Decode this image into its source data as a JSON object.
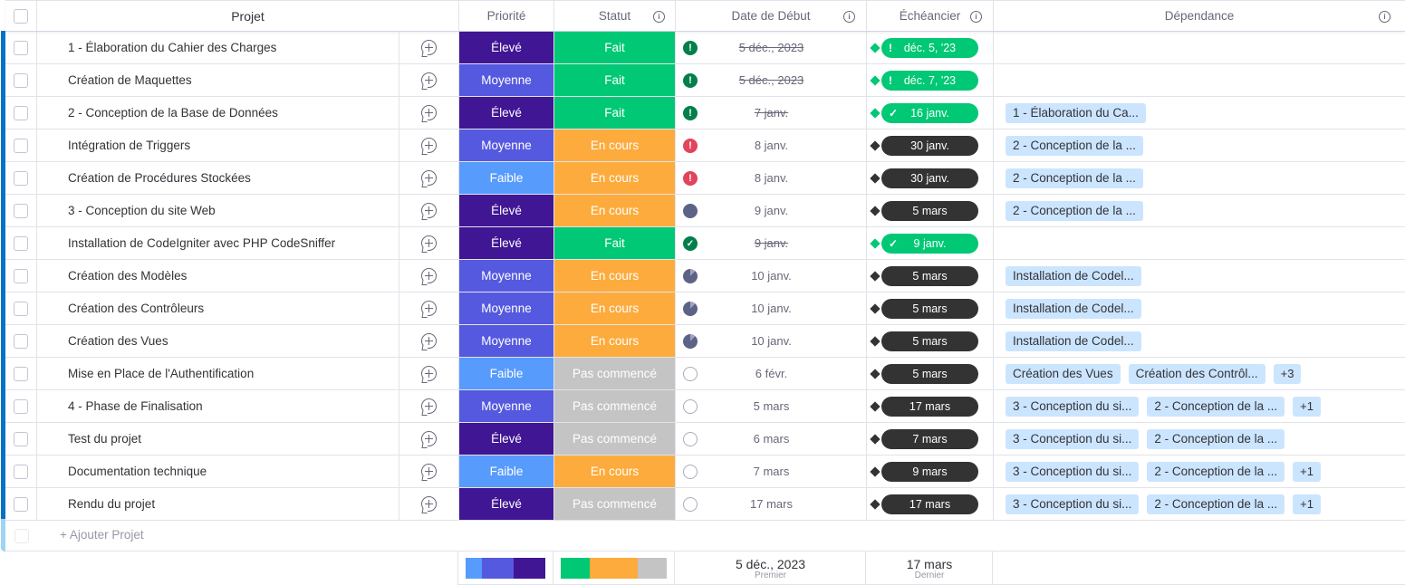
{
  "columns": {
    "name": "Projet",
    "priority": "Priorité",
    "status": "Statut",
    "start_date": "Date de Début",
    "due": "Échéancier",
    "dependency": "Dépendance"
  },
  "colors": {
    "prio_high": "#401694",
    "prio_medium": "#5559df",
    "prio_low": "#579bfc",
    "status_done": "#00c875",
    "status_working": "#fdab3d",
    "status_not_started": "#c4c4c4",
    "done_icon": "#037f4c",
    "alert_icon": "#e2445c",
    "progress_icon": "#5d6387",
    "due_done": "#00c875",
    "due_pending": "#333333",
    "dependency_tag": "#cce5ff",
    "group_accent": "#0073c2"
  },
  "rows": [
    {
      "name": "1 - Élaboration du Cahier des Charges",
      "priority": "Élevé",
      "priority_level": "high",
      "status": "Fait",
      "status_level": "done",
      "date_icon": "alert-done",
      "start": "5 déc., 2023",
      "strike": true,
      "due": "déc. 5, '23",
      "due_state": "done-late",
      "deps": []
    },
    {
      "name": "Création de Maquettes",
      "priority": "Moyenne",
      "priority_level": "medium",
      "status": "Fait",
      "status_level": "done",
      "date_icon": "alert-done",
      "start": "5 déc., 2023",
      "strike": true,
      "due": "déc. 7, '23",
      "due_state": "done-late",
      "deps": []
    },
    {
      "name": "2 - Conception de la Base de Données",
      "priority": "Élevé",
      "priority_level": "high",
      "status": "Fait",
      "status_level": "done",
      "date_icon": "alert-done",
      "start": "7 janv.",
      "strike": true,
      "due": "16 janv.",
      "due_state": "done",
      "deps": [
        "1 - Élaboration du Ca..."
      ]
    },
    {
      "name": "Intégration de Triggers",
      "priority": "Moyenne",
      "priority_level": "medium",
      "status": "En cours",
      "status_level": "working",
      "date_icon": "alert",
      "start": "8 janv.",
      "strike": false,
      "due": "30 janv.",
      "due_state": "pending",
      "deps": [
        "2 - Conception de la ..."
      ]
    },
    {
      "name": "Création de Procédures Stockées",
      "priority": "Faible",
      "priority_level": "low",
      "status": "En cours",
      "status_level": "working",
      "date_icon": "alert",
      "start": "8 janv.",
      "strike": false,
      "due": "30 janv.",
      "due_state": "pending",
      "deps": [
        "2 - Conception de la ..."
      ]
    },
    {
      "name": "3 - Conception du site Web",
      "priority": "Élevé",
      "priority_level": "high",
      "status": "En cours",
      "status_level": "working",
      "date_icon": "progress-full",
      "start": "9 janv.",
      "strike": false,
      "due": "5 mars",
      "due_state": "pending",
      "deps": [
        "2 - Conception de la ..."
      ]
    },
    {
      "name": "Installation de CodeIgniter avec PHP CodeSniffer",
      "priority": "Élevé",
      "priority_level": "high",
      "status": "Fait",
      "status_level": "done",
      "date_icon": "check",
      "start": "9 janv.",
      "strike": true,
      "due": "9 janv.",
      "due_state": "done",
      "deps": []
    },
    {
      "name": "Création des Modèles",
      "priority": "Moyenne",
      "priority_level": "medium",
      "status": "En cours",
      "status_level": "working",
      "date_icon": "progress",
      "start": "10 janv.",
      "strike": false,
      "due": "5 mars",
      "due_state": "pending",
      "deps": [
        "Installation de Codel..."
      ]
    },
    {
      "name": "Création des Contrôleurs",
      "priority": "Moyenne",
      "priority_level": "medium",
      "status": "En cours",
      "status_level": "working",
      "date_icon": "progress",
      "start": "10 janv.",
      "strike": false,
      "due": "5 mars",
      "due_state": "pending",
      "deps": [
        "Installation de Codel..."
      ]
    },
    {
      "name": "Création des Vues",
      "priority": "Moyenne",
      "priority_level": "medium",
      "status": "En cours",
      "status_level": "working",
      "date_icon": "progress",
      "start": "10 janv.",
      "strike": false,
      "due": "5 mars",
      "due_state": "pending",
      "deps": [
        "Installation de Codel..."
      ]
    },
    {
      "name": "Mise en Place de l'Authentification",
      "priority": "Faible",
      "priority_level": "low",
      "status": "Pas commencé",
      "status_level": "not_started",
      "date_icon": "empty",
      "start": "6 févr.",
      "strike": false,
      "due": "5 mars",
      "due_state": "pending",
      "deps": [
        "Création des Vues",
        "Création des Contrôl..."
      ],
      "more": "+3"
    },
    {
      "name": "4 - Phase de Finalisation",
      "priority": "Moyenne",
      "priority_level": "medium",
      "status": "Pas commencé",
      "status_level": "not_started",
      "date_icon": "empty",
      "start": "5 mars",
      "strike": false,
      "due": "17 mars",
      "due_state": "pending",
      "deps": [
        "3 - Conception du si...",
        "2 - Conception de la ..."
      ],
      "more": "+1"
    },
    {
      "name": "Test du projet",
      "priority": "Élevé",
      "priority_level": "high",
      "status": "Pas commencé",
      "status_level": "not_started",
      "date_icon": "empty",
      "start": "6 mars",
      "strike": false,
      "due": "7 mars",
      "due_state": "pending",
      "deps": [
        "3 - Conception du si...",
        "2 - Conception de la ..."
      ]
    },
    {
      "name": "Documentation technique",
      "priority": "Faible",
      "priority_level": "low",
      "status": "En cours",
      "status_level": "working",
      "date_icon": "empty",
      "start": "7 mars",
      "strike": false,
      "due": "9 mars",
      "due_state": "pending",
      "deps": [
        "3 - Conception du si...",
        "2 - Conception de la ..."
      ],
      "more": "+1"
    },
    {
      "name": "Rendu du projet",
      "priority": "Élevé",
      "priority_level": "high",
      "status": "Pas commencé",
      "status_level": "not_started",
      "date_icon": "empty",
      "start": "17 mars",
      "strike": false,
      "due": "17 mars",
      "due_state": "pending",
      "deps": [
        "3 - Conception du si...",
        "2 - Conception de la ..."
      ],
      "more": "+1"
    }
  ],
  "add_row": {
    "label": "+ Ajouter Projet"
  },
  "summary": {
    "priority_distribution": [
      {
        "level": "low",
        "fraction": 0.2
      },
      {
        "level": "medium",
        "fraction": 0.4
      },
      {
        "level": "high",
        "fraction": 0.4
      }
    ],
    "status_distribution": [
      {
        "level": "done",
        "fraction": 0.27
      },
      {
        "level": "working",
        "fraction": 0.46
      },
      {
        "level": "not_started",
        "fraction": 0.27
      }
    ],
    "start_first": "5 déc., 2023",
    "start_first_label": "Premier",
    "due_last": "17 mars",
    "due_last_label": "Dernier"
  }
}
